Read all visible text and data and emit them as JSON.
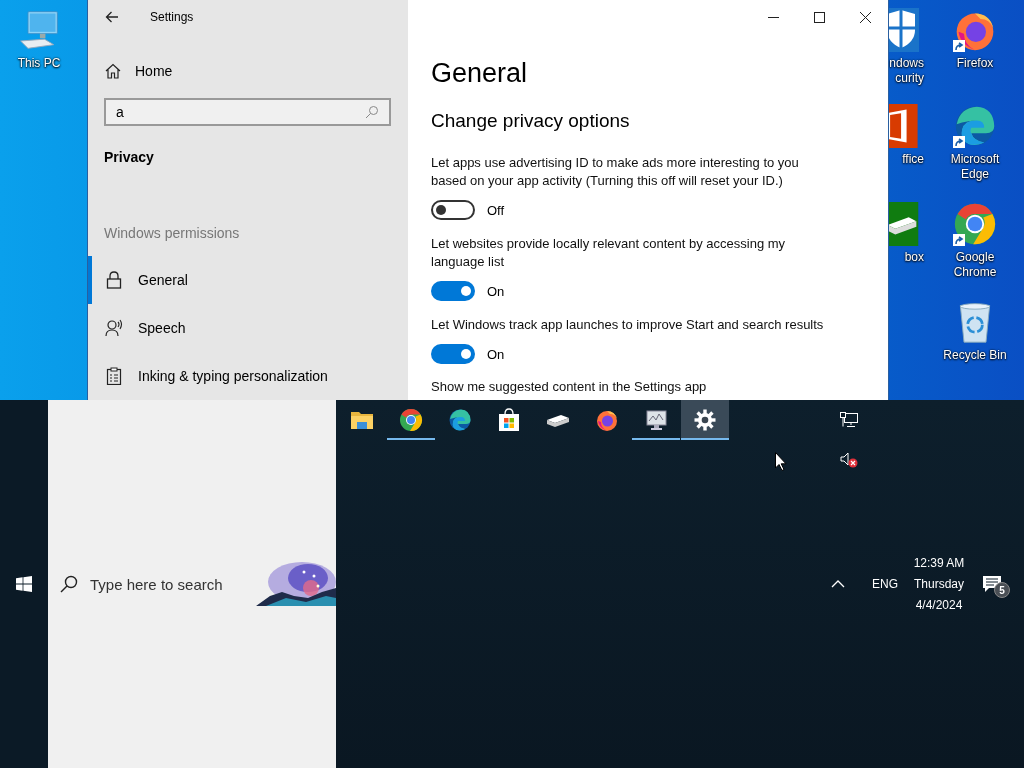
{
  "desktop": {
    "icons": [
      {
        "kind": "computer",
        "label": "This PC"
      },
      {
        "kind": "shield",
        "label": "ndows curity"
      },
      {
        "kind": "firefox",
        "label": "Firefox"
      },
      {
        "kind": "office",
        "label": "ffice"
      },
      {
        "kind": "edge",
        "label": "Microsoft Edge"
      },
      {
        "kind": "xbox",
        "label": "box"
      },
      {
        "kind": "chrome",
        "label": "Google Chrome"
      },
      {
        "kind": "recycle",
        "label": "Recycle Bin"
      }
    ]
  },
  "settings": {
    "title": "Settings",
    "home": "Home",
    "search": {
      "value": "a"
    },
    "section": "Privacy",
    "group": "Windows permissions",
    "nav_items": [
      {
        "kind": "lock",
        "label": "General",
        "selected": true
      },
      {
        "kind": "speech",
        "label": "Speech",
        "selected": false
      },
      {
        "kind": "clipboard",
        "label": "Inking & typing personalization",
        "selected": false
      }
    ],
    "page_title": "General",
    "heading": "Change privacy options",
    "options": [
      {
        "text": "Let apps use advertising ID to make ads more interesting to you based on your app activity (Turning this off will reset your ID.)",
        "on": false,
        "state_label": "Off"
      },
      {
        "text": "Let websites provide locally relevant content by accessing my language list",
        "on": true,
        "state_label": "On"
      },
      {
        "text": "Let Windows track app launches to improve Start and search results",
        "on": true,
        "state_label": "On"
      }
    ],
    "next_option_text": "Show me suggested content in the Settings app"
  },
  "taskbar": {
    "search": {
      "placeholder": "Type here to search"
    },
    "apps": [
      {
        "kind": "folder",
        "running": false,
        "selected": false
      },
      {
        "kind": "chrome",
        "running": true,
        "selected": false
      },
      {
        "kind": "edge",
        "running": false,
        "selected": false
      },
      {
        "kind": "store",
        "running": false,
        "selected": false
      },
      {
        "kind": "drive",
        "running": false,
        "selected": false
      },
      {
        "kind": "firefox",
        "running": false,
        "selected": false
      },
      {
        "kind": "monitor",
        "running": true,
        "selected": false
      },
      {
        "kind": "gear",
        "running": true,
        "selected": true
      }
    ],
    "language": "ENG",
    "time": "12:39 AM",
    "day": "Thursday",
    "date": "4/4/2024",
    "notification_count": "5"
  }
}
